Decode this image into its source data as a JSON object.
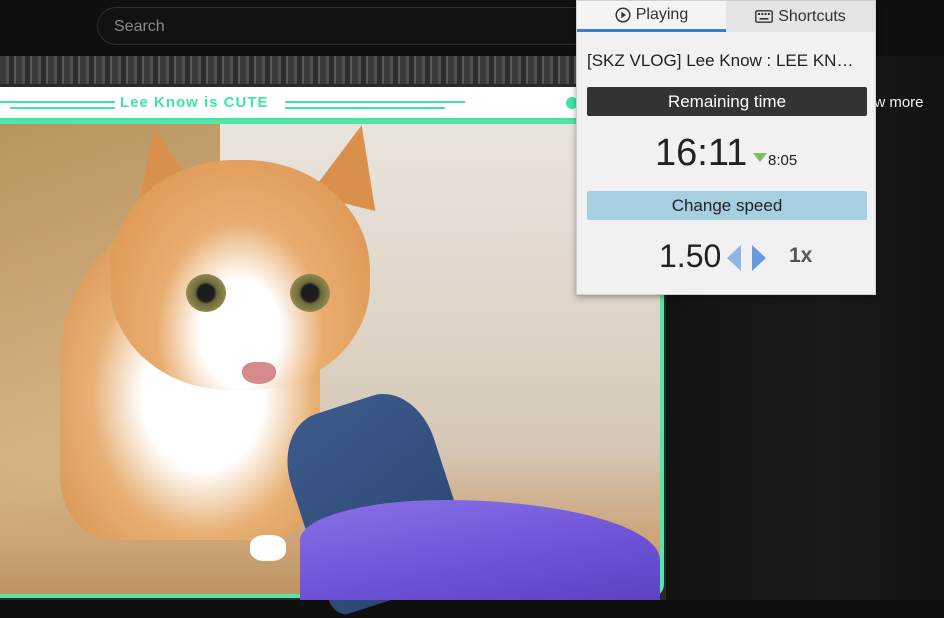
{
  "search": {
    "placeholder": "Search"
  },
  "sidebar": {
    "show_more": "ow more"
  },
  "video": {
    "banner_text": "Lee Know is CUTE"
  },
  "popup": {
    "tabs": [
      {
        "label": "Playing",
        "icon": "play-circle-icon",
        "active": true
      },
      {
        "label": "Shortcuts",
        "icon": "keyboard-icon",
        "active": false
      }
    ],
    "video_title": "[SKZ VLOG] Lee Know : LEE KN…",
    "remaining_label": "Remaining time",
    "remaining_time": "16:11",
    "time_saved": "8:05",
    "change_speed_label": "Change speed",
    "speed_value": "1.50",
    "reset_label": "1x"
  },
  "colors": {
    "accent_green": "#3ee6a6",
    "tab_underline": "#3a7fd4",
    "speed_bar": "#a7cfe2",
    "arrow_blue": "#6a98e0"
  }
}
